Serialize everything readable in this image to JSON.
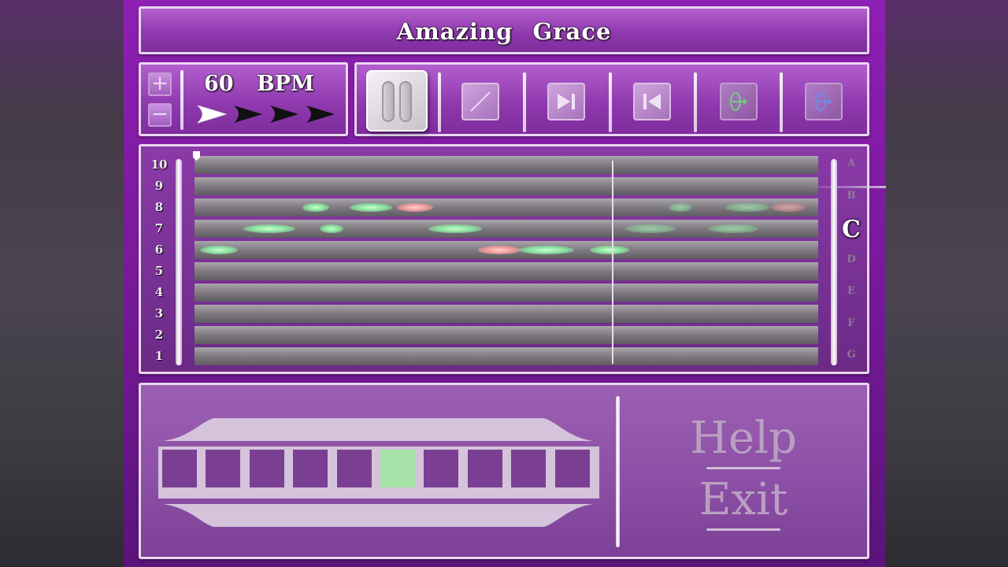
{
  "app": {
    "song_title": "Amazing Grace"
  },
  "tempo": {
    "bpm_label": "60 BPM",
    "increase_symbol": "+",
    "decrease_symbol": "−",
    "beats_total": 4,
    "current_beat": 1
  },
  "transport": {
    "buttons": [
      {
        "name": "pause",
        "icon": "pause-icon",
        "state": "active"
      },
      {
        "name": "edit",
        "icon": "pencil-slash-icon",
        "state": "enabled"
      },
      {
        "name": "skip-forward",
        "icon": "skip-to-end-icon",
        "state": "enabled"
      },
      {
        "name": "skip-back",
        "icon": "skip-to-start-icon",
        "state": "enabled"
      },
      {
        "name": "blow-draw-green",
        "icon": "harmonica-blow-icon",
        "state": "disabled"
      },
      {
        "name": "blow-draw-blue",
        "icon": "harmonica-draw-icon",
        "state": "disabled"
      }
    ]
  },
  "staff": {
    "hole_numbers": [
      "10",
      "9",
      "8",
      "7",
      "6",
      "5",
      "4",
      "3",
      "2",
      "1"
    ],
    "note_letters": [
      "A",
      "B",
      "C",
      "D",
      "E",
      "F",
      "G"
    ],
    "active_note": "C",
    "notes": [
      {
        "hole": 6,
        "type": "blow"
      },
      {
        "hole": 7,
        "type": "blow"
      },
      {
        "hole": 8,
        "type": "blow"
      },
      {
        "hole": 7,
        "type": "blow"
      },
      {
        "hole": 8,
        "type": "blow"
      },
      {
        "hole": 8,
        "type": "draw"
      },
      {
        "hole": 7,
        "type": "blow"
      },
      {
        "hole": 6,
        "type": "draw"
      },
      {
        "hole": 6,
        "type": "blow"
      },
      {
        "hole": 6,
        "type": "blow"
      },
      {
        "hole": 7,
        "type": "blow"
      },
      {
        "hole": 8,
        "type": "blow"
      },
      {
        "hole": 7,
        "type": "blow"
      },
      {
        "hole": 8,
        "type": "blow"
      },
      {
        "hole": 8,
        "type": "draw"
      }
    ]
  },
  "harmonica": {
    "hole_count": 10,
    "active_hole": 6
  },
  "menu": {
    "help_label": "Help",
    "exit_label": "Exit"
  },
  "colors": {
    "frame_purple": "#8e1fb4",
    "blow_note": "#8be39f",
    "draw_note": "#f29a9a",
    "active_hole": "#a7e3a9"
  }
}
